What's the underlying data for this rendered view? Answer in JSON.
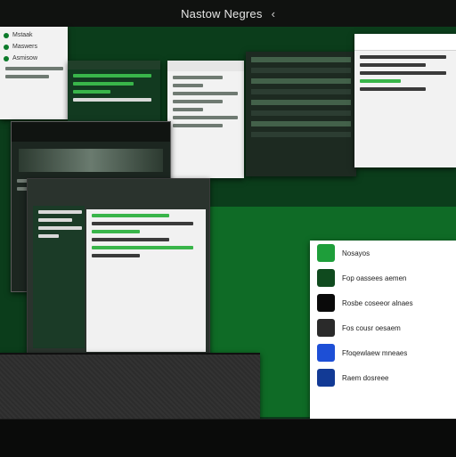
{
  "window": {
    "title": "Nastow Negres",
    "chevron_icon": "chevron-left-icon"
  },
  "colors": {
    "desktop": "#0b3d1b",
    "stage_green": "#0f6b26",
    "accent_green": "#39b54a",
    "dark": "#1b231d"
  },
  "panel_right_list": {
    "items": [
      {
        "label": "Nosayos",
        "sub": ""
      },
      {
        "label": "Fop oassees aemen",
        "sub": ""
      },
      {
        "label": "Rosbe coseeor alnaes",
        "sub": ""
      },
      {
        "label": "Fos cousr oesaem",
        "sub": ""
      },
      {
        "label": "Ffoqewlaew mneaes",
        "sub": ""
      },
      {
        "label": "Raem dosreee",
        "sub": ""
      }
    ]
  },
  "left_window": {
    "rows": [
      {
        "label": "Mstaak"
      },
      {
        "label": "Maswers"
      },
      {
        "label": "Asmisow"
      }
    ]
  }
}
